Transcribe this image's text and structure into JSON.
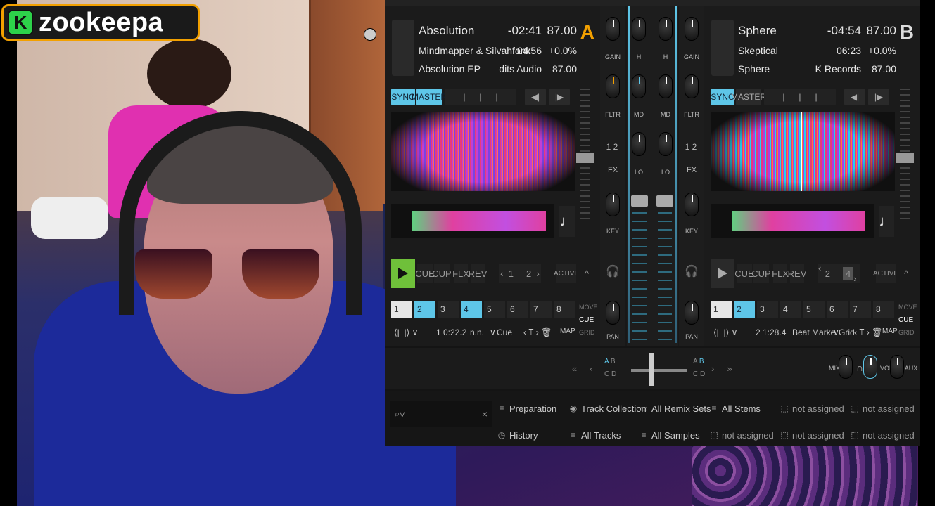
{
  "overlay": {
    "logo_text": "zookeepa",
    "logo_badge": "K",
    "logo_color": "#f2a000"
  },
  "deckA": {
    "letter": "A",
    "title": "Absolution",
    "remaining": "-02:41",
    "bpm": "87.00",
    "artist": "Mindmapper & Silvahfonk",
    "length": "04:56",
    "tempo": "+0.0%",
    "album": "Absolution EP",
    "label": "dits Audio",
    "bpm2": "87.00",
    "sync": "SYNC",
    "master": "MASTER",
    "cue": "CUE",
    "cup": "CUP",
    "flx": "FLX",
    "rev": "REV",
    "loop1": "1",
    "loop2": "2",
    "active": "ACTIVE",
    "cues": [
      "1",
      "2",
      "3",
      "4",
      "5",
      "6",
      "7",
      "8"
    ],
    "side_move": "MOVE",
    "side_cue": "CUE",
    "side_grid": "GRID",
    "beat_num": "1",
    "beat_pos": "0:22.2",
    "beat_name": "n.n.",
    "beat_type": "Cue",
    "map": "MAP"
  },
  "deckB": {
    "letter": "B",
    "title": "Sphere",
    "remaining": "-04:54",
    "bpm": "87.00",
    "artist": "Skeptical",
    "length": "06:23",
    "tempo": "+0.0%",
    "album": "Sphere",
    "label": "K Records",
    "bpm2": "87.00",
    "sync": "SYNC",
    "master": "MASTER",
    "cue": "CUE",
    "cup": "CUP",
    "flx": "FLX",
    "rev": "REV",
    "loop1": "2",
    "loop2": "4",
    "active": "ACTIVE",
    "cues": [
      "1",
      "2",
      "3",
      "4",
      "5",
      "6",
      "7",
      "8"
    ],
    "side_move": "MOVE",
    "side_cue": "CUE",
    "side_grid": "GRID",
    "beat_num": "2",
    "beat_pos": "1:28.4",
    "beat_name": "Beat Marke",
    "beat_type": "Grid",
    "map": "MAP"
  },
  "mixer": {
    "gain": "GAIN",
    "h": "H",
    "md": "MD",
    "lo": "LO",
    "fltr": "FLTR",
    "fx": "FX",
    "fx1": "1",
    "fx2": "2",
    "key": "KEY",
    "pan": "PAN"
  },
  "xfader": {
    "a": "A",
    "b": "B",
    "c": "C",
    "d": "D",
    "mix": "MIX",
    "vol": "VOL",
    "aux": "AUX"
  },
  "browser": {
    "row1": [
      "Preparation",
      "Track Collection",
      "All Remix Sets",
      "All Stems",
      "not assigned",
      "not assigned"
    ],
    "row2": [
      "History",
      "All Tracks",
      "All Samples",
      "not assigned",
      "not assigned",
      "not assigned"
    ]
  },
  "colors": {
    "accent": "#5ec6e8",
    "play": "#6fc03a",
    "deckA": "#f2a000"
  }
}
